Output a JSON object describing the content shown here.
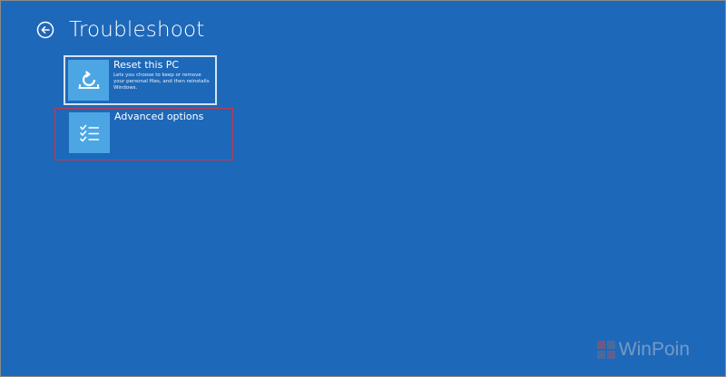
{
  "header": {
    "title": "Troubleshoot",
    "back_icon": "back-arrow-icon"
  },
  "tiles": [
    {
      "title": "Reset this PC",
      "description": "Lets you choose to keep or remove your personal files, and then reinstalls Windows.",
      "icon": "reset-pc-icon",
      "selected": true
    },
    {
      "title": "Advanced options",
      "description": "",
      "icon": "checklist-icon",
      "highlighted": true
    }
  ],
  "watermark": {
    "text": "WinPoin"
  },
  "colors": {
    "background": "#1e68b9",
    "tile_icon_bg": "#4ca6e4",
    "highlight_border": "#c8384a",
    "selected_border": "#d4e3f3"
  }
}
